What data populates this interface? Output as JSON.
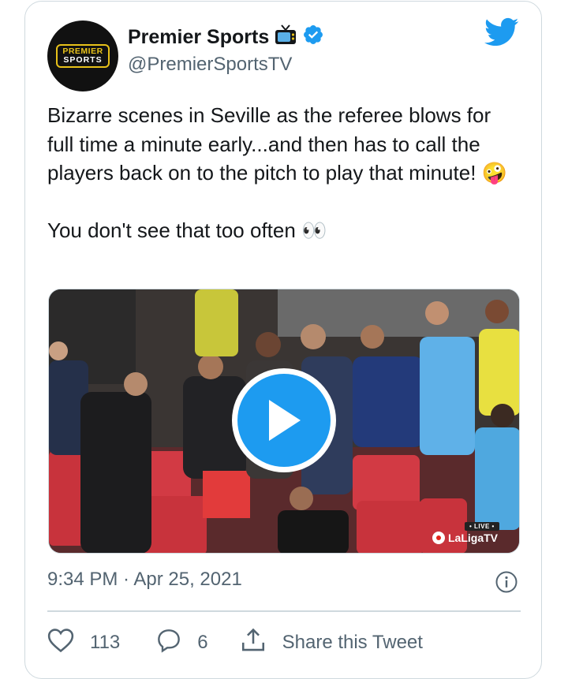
{
  "account": {
    "logo_top": "PREMIER",
    "logo_bottom": "SPORTS",
    "display_name": "Premier Sports",
    "handle": "@PremierSportsTV"
  },
  "tweet": {
    "line1": "Bizarre scenes in Seville as the referee blows for full time a minute early...and then has to call the players back on to the pitch to play that minute! 🤪",
    "line2": "You don't see that too often 👀",
    "timestamp": "9:34 PM · Apr 25, 2021"
  },
  "media": {
    "live_label": "• LIVE •",
    "watermark": "LaLigaTV"
  },
  "actions": {
    "likes": "113",
    "replies": "6",
    "share_label": "Share this Tweet"
  },
  "colors": {
    "twitter_blue": "#1d9bf0",
    "muted_text": "#536471",
    "border": "#cfd9de"
  },
  "icons": [
    "tv-icon",
    "verified-icon",
    "twitter-bird-icon",
    "play-icon",
    "info-icon",
    "heart-icon",
    "reply-icon",
    "share-icon"
  ]
}
